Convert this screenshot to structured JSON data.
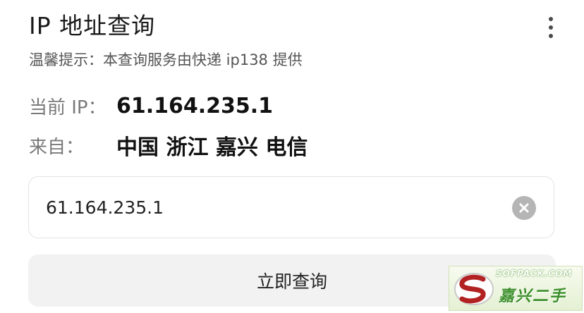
{
  "header": {
    "title": "IP 地址查询"
  },
  "notice": {
    "text": "温馨提示：本查询服务由快递 ip138 提供"
  },
  "info": {
    "current_ip_label": "当前 IP：",
    "current_ip_value": "61.164.235.1",
    "from_label": "来自：",
    "from_value": "中国 浙江 嘉兴 电信"
  },
  "search": {
    "value": "61.164.235.1"
  },
  "actions": {
    "submit_label": "立即查询"
  },
  "watermark": {
    "site": "SOFPACK.COM",
    "name": "嘉兴二手"
  },
  "icons": {
    "more": "more-vertical-icon",
    "clear": "clear-circle-icon"
  },
  "colors": {
    "background": "#ffffff",
    "input_border": "#e3e3e3",
    "button_bg": "#f2f2f2",
    "clear_icon_bg": "#b5b5b5"
  }
}
